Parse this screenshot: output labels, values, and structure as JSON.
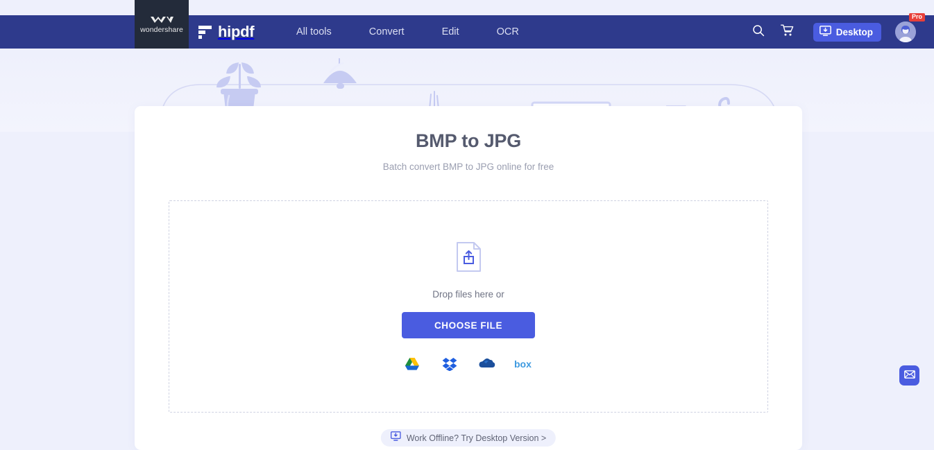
{
  "brand": {
    "parent_name": "wondershare",
    "parent_logo_icon": "wondershare-w-icon",
    "product_name": "hipdf",
    "product_logo_icon": "hipdf-mark-icon"
  },
  "nav": {
    "links": [
      {
        "label": "All tools"
      },
      {
        "label": "Convert"
      },
      {
        "label": "Edit"
      },
      {
        "label": "OCR"
      }
    ],
    "search_icon": "search-icon",
    "cart_icon": "shopping-cart-icon",
    "desktop_button": {
      "label": "Desktop",
      "icon": "monitor-download-icon"
    },
    "account": {
      "badge": "Pro",
      "avatar_icon": "user-avatar-icon"
    }
  },
  "main": {
    "title": "BMP to JPG",
    "subtitle": "Batch convert BMP to JPG online for free",
    "dropzone": {
      "upload_icon": "file-upload-icon",
      "drop_text": "Drop files here or",
      "choose_button": "CHOOSE FILE",
      "cloud_sources": [
        {
          "name": "Google Drive",
          "icon": "google-drive-icon"
        },
        {
          "name": "Dropbox",
          "icon": "dropbox-icon"
        },
        {
          "name": "OneDrive",
          "icon": "onedrive-icon"
        },
        {
          "name": "Box",
          "icon": "box-icon"
        }
      ]
    },
    "offline_pill": {
      "label": "Work Offline? Try Desktop Version >",
      "icon": "monitor-download-icon"
    }
  },
  "floating": {
    "mail_icon": "envelope-icon"
  },
  "colors": {
    "page_background": "#eef0fc",
    "navbar": "#2e3a8c",
    "wondershare_box": "#232b3a",
    "accent_blue": "#4a5ce0",
    "pro_badge": "#e8403a",
    "title_text": "#555a6e",
    "subtitle_text": "#9a9eb0",
    "illustration": "#c6cbf2"
  }
}
